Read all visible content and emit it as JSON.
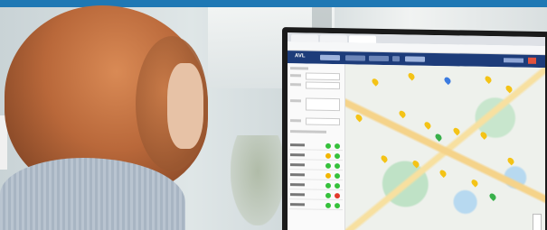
{
  "scene": {
    "description_tags": [
      "person-back-view",
      "desktop-monitor",
      "web-map-application"
    ],
    "colors": {
      "top_strip": "#1f78b4",
      "app_header": "#1d3c7a",
      "map_background": "#eef1ec",
      "pin_yellow": "#f4c316",
      "pin_blue": "#3b7be0",
      "pin_green": "#38b04a",
      "status_green": "#35c13b",
      "status_yellow": "#f2b600",
      "status_red": "#e23a2c"
    }
  },
  "screen": {
    "app_logo_text": "AVL",
    "nav_items": [
      "",
      "",
      "",
      "",
      ""
    ],
    "list_rows": [
      {
        "status_a": "#35c13b",
        "status_b": "#35c13b"
      },
      {
        "status_a": "#f2b600",
        "status_b": "#35c13b"
      },
      {
        "status_a": "#35c13b",
        "status_b": "#35c13b"
      },
      {
        "status_a": "#f2b600",
        "status_b": "#35c13b"
      },
      {
        "status_a": "#35c13b",
        "status_b": "#35c13b"
      },
      {
        "status_a": "#35c13b",
        "status_b": "#e23a2c"
      },
      {
        "status_a": "#35c13b",
        "status_b": "#35c13b"
      }
    ]
  }
}
